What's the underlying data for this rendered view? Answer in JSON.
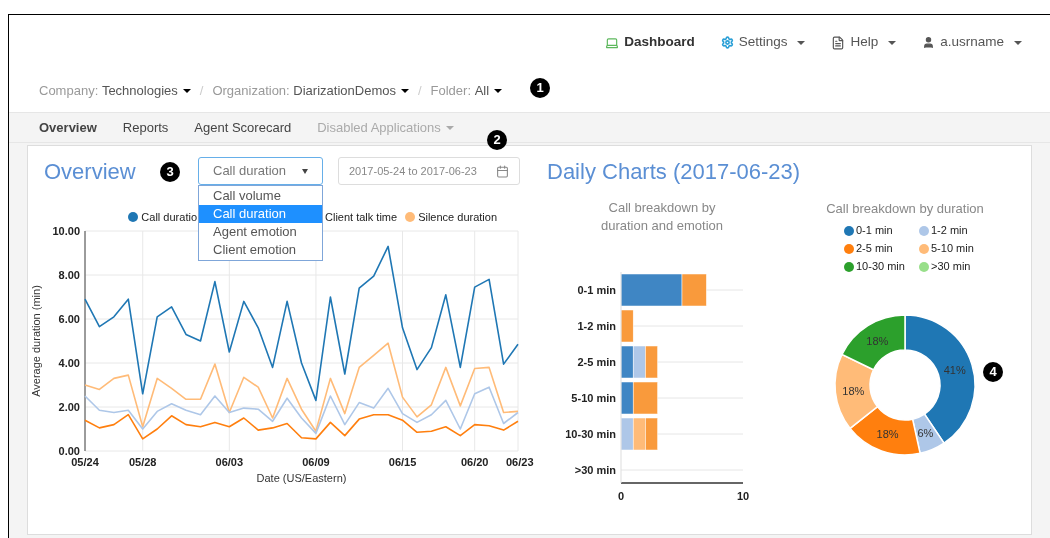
{
  "navbar": {
    "items": [
      {
        "label": "Dashboard",
        "selected": true,
        "has_menu": false
      },
      {
        "label": "Settings",
        "selected": false,
        "has_menu": true
      },
      {
        "label": "Help",
        "selected": false,
        "has_menu": true
      },
      {
        "label": "a.usrname",
        "selected": false,
        "has_menu": true
      }
    ]
  },
  "breadcrumbs": [
    {
      "label": "Company:",
      "value": "Technologies"
    },
    {
      "separator": "/",
      "label": "Organization:",
      "value": "DiarizationDemos"
    },
    {
      "separator": "/",
      "label": "Folder:",
      "value": "All"
    }
  ],
  "tabs": [
    {
      "label": "Overview",
      "selected": true,
      "disabled": false,
      "has_menu": false
    },
    {
      "label": "Reports",
      "selected": false,
      "disabled": false,
      "has_menu": false
    },
    {
      "label": "Agent Scorecard",
      "selected": false,
      "disabled": false,
      "has_menu": false
    },
    {
      "label": "Disabled Applications",
      "selected": false,
      "disabled": true,
      "has_menu": true
    }
  ],
  "callouts": [
    "1",
    "2",
    "3",
    "4"
  ],
  "overview": {
    "title": "Overview",
    "metric_select": {
      "value": "Call duration",
      "options": [
        {
          "label": "Call volume",
          "selected": false
        },
        {
          "label": "Call duration",
          "selected": true
        },
        {
          "label": "Agent emotion",
          "selected": false
        },
        {
          "label": "Client emotion",
          "selected": false
        }
      ]
    },
    "date_range": {
      "value": "2017-05-24 to 2017-06-23"
    },
    "legend": [
      {
        "label": "Call duratio",
        "color": "#1f77b4"
      },
      {
        "label": "Client talk time"
      },
      {
        "label": "Silence duration",
        "color": "#ffbb78"
      }
    ],
    "chart_data": {
      "type": "line",
      "xlabel": "Date (US/Eastern)",
      "ylabel": "Average duration (min)",
      "categories": [
        "05/24",
        null,
        null,
        null,
        "05/28",
        null,
        null,
        null,
        null,
        null,
        "06/03",
        null,
        null,
        null,
        null,
        null,
        "06/09",
        null,
        null,
        null,
        null,
        null,
        "06/15",
        null,
        null,
        null,
        null,
        "06/20",
        null,
        null,
        "06/23"
      ],
      "series": [
        {
          "color": "#1f77b4",
          "values": [
            6.9,
            5.65,
            6.1,
            6.9,
            2.6,
            6.1,
            6.55,
            5.3,
            5.0,
            7.7,
            4.5,
            6.8,
            5.6,
            3.8,
            6.8,
            4.0,
            2.3,
            7.0,
            3.5,
            7.4,
            7.95,
            9.3,
            5.6,
            3.7,
            4.7,
            7.1,
            3.8,
            7.45,
            7.8,
            3.95,
            4.85
          ]
        },
        {
          "color": "#ffbb78",
          "values": [
            3.0,
            2.8,
            3.3,
            3.45,
            1.1,
            3.3,
            2.85,
            2.35,
            2.35,
            3.95,
            1.75,
            3.35,
            2.9,
            1.5,
            3.3,
            1.9,
            0.9,
            3.3,
            1.7,
            3.8,
            4.35,
            4.9,
            2.45,
            1.55,
            2.1,
            3.8,
            2.05,
            3.75,
            3.8,
            1.75,
            1.8
          ]
        },
        {
          "color": "#aec7e8",
          "values": [
            2.5,
            1.85,
            1.75,
            1.85,
            1.0,
            1.8,
            2.15,
            1.85,
            1.65,
            2.5,
            1.75,
            1.95,
            1.9,
            1.35,
            2.4,
            1.5,
            0.8,
            2.5,
            1.2,
            2.2,
            1.95,
            2.85,
            1.7,
            1.3,
            1.65,
            2.3,
            1.0,
            2.6,
            2.9,
            1.25,
            1.75
          ]
        },
        {
          "color": "#ff7f0e",
          "values": [
            1.4,
            1.05,
            1.2,
            1.65,
            0.55,
            1.0,
            1.6,
            1.2,
            1.1,
            1.3,
            1.1,
            1.5,
            0.95,
            1.05,
            1.25,
            0.6,
            0.55,
            1.3,
            0.7,
            1.45,
            1.65,
            1.65,
            1.4,
            0.85,
            0.9,
            1.1,
            0.7,
            1.2,
            1.15,
            0.95,
            1.35
          ]
        }
      ],
      "ylim": [
        0,
        10
      ],
      "grid": true,
      "yticks": [
        {
          "value": 0,
          "label": "0.00"
        },
        {
          "value": 2,
          "label": "2.00"
        },
        {
          "value": 4,
          "label": "4.00"
        },
        {
          "value": 6,
          "label": "6.00"
        },
        {
          "value": 8,
          "label": "8.00"
        },
        {
          "value": 10,
          "label": "10.00"
        }
      ]
    }
  },
  "daily": {
    "title": "Daily Charts (2017-06-23)",
    "bar_chart": {
      "chart_data": {
        "type": "bar",
        "orientation": "horizontal",
        "stacked": true,
        "title": "Call breakdown by duration and emotion",
        "categories": [
          "0-1 min",
          "1-2 min",
          "2-5 min",
          "5-10 min",
          "10-30 min",
          ">30 min"
        ],
        "series": [
          {
            "color": "#3f86c4",
            "values": [
              5,
              0,
              1,
              1,
              0,
              0
            ]
          },
          {
            "color": "#aec7e8",
            "values": [
              0,
              0,
              1,
              0,
              1,
              0
            ]
          },
          {
            "color": "#ffbb78",
            "values": [
              0,
              0,
              0,
              0,
              1,
              0
            ]
          },
          {
            "color": "#f99a3c",
            "values": [
              2,
              1,
              1,
              2,
              1,
              0
            ]
          }
        ],
        "xlim": [
          0,
          10
        ],
        "xticks": [
          0,
          10
        ]
      }
    },
    "donut_chart": {
      "chart_data": {
        "type": "donut",
        "title": "Call breakdown by duration",
        "categories": [
          "0-1 min",
          "1-2 min",
          "2-5 min",
          "5-10 min",
          "10-30 min",
          ">30 min"
        ],
        "values": [
          41,
          6,
          18,
          18,
          18,
          0
        ],
        "colors": [
          "#1f77b4",
          "#aec7e8",
          "#ff7f0e",
          "#ffbb78",
          "#2ca02c",
          "#98df8a"
        ],
        "value_labels": [
          "41%",
          "6%",
          "18%",
          "18%",
          "18%",
          null
        ]
      }
    }
  }
}
